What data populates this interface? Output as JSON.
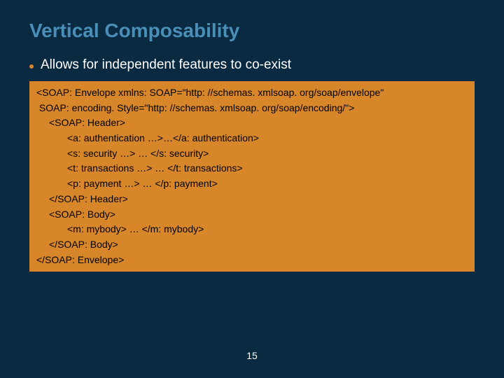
{
  "title": "Vertical Composability",
  "bullet": "Allows for independent features to co-exist",
  "code": {
    "l0": "<SOAP: Envelope xmlns: SOAP=\"http: //schemas. xmlsoap. org/soap/envelope\"",
    "l1": " SOAP: encoding. Style=\"http: //schemas. xmlsoap. org/soap/encoding/\">",
    "l2": "<SOAP: Header>",
    "l3": "<a: authentication …>…</a: authentication>",
    "l4": "<s: security …> … </s: security>",
    "l5": "<t: transactions …> … </t: transactions>",
    "l6": "<p: payment …> … </p: payment>",
    "l7": "</SOAP: Header>",
    "l8": "<SOAP: Body>",
    "l9": "<m: mybody> … </m: mybody>",
    "l10": "</SOAP: Body>",
    "l11": "</SOAP: Envelope>"
  },
  "page": "15"
}
